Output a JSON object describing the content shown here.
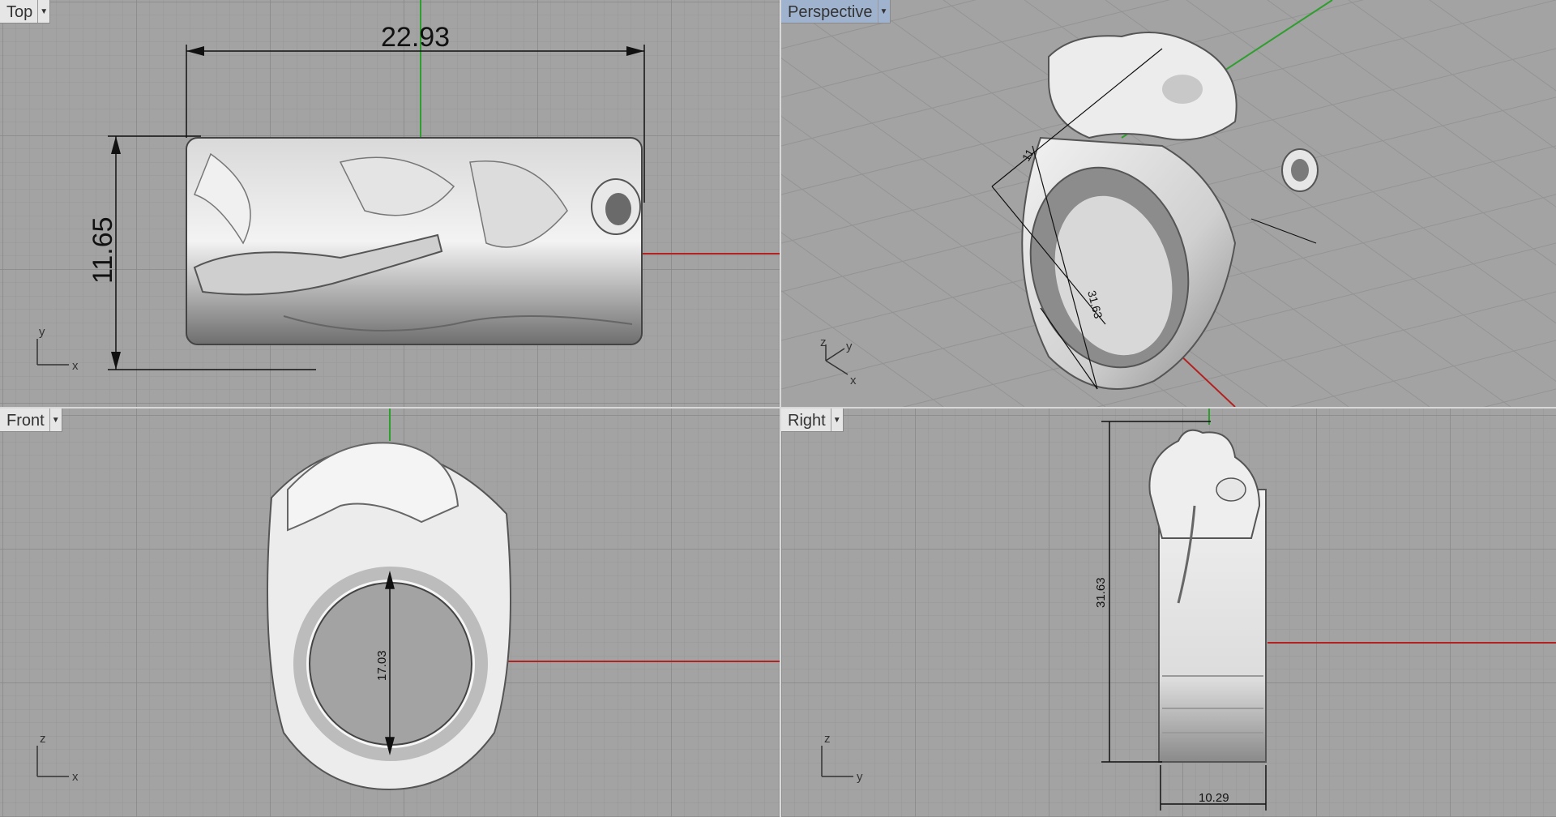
{
  "viewports": {
    "top": {
      "title": "Top",
      "dim_width": "22.93",
      "dim_height": "11.65",
      "axis_v": "y",
      "axis_h": "x"
    },
    "perspective": {
      "title": "Perspective",
      "dim_a": "11",
      "dim_b": "31.63",
      "axis_z": "z",
      "axis_y": "y",
      "axis_x": "x"
    },
    "front": {
      "title": "Front",
      "dim_inner": "17.03",
      "axis_v": "z",
      "axis_h": "x"
    },
    "right": {
      "title": "Right",
      "dim_height": "31.63",
      "dim_width": "10.29",
      "axis_v": "z",
      "axis_h": "y"
    }
  },
  "colors": {
    "background": "#a3a3a3",
    "grid_minor": "#999999",
    "grid_major": "#8c8c8c",
    "axis_x": "#b22222",
    "axis_y": "#2e9e2e",
    "active_tab": "#9fb3cf"
  },
  "icons": {
    "dropdown": "chevron-down-icon"
  }
}
